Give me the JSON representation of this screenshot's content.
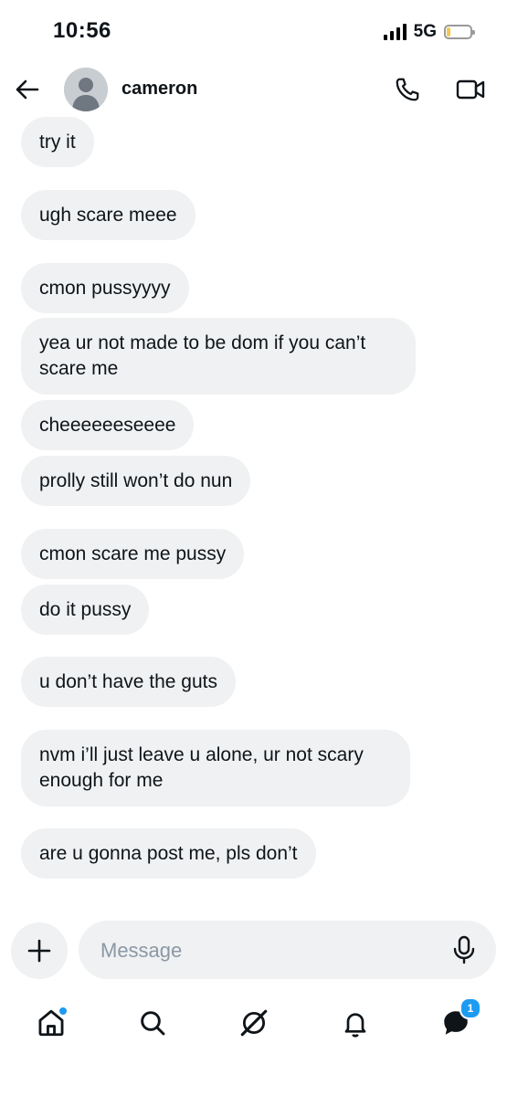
{
  "status_bar": {
    "time": "10:56",
    "network": "5G",
    "battery_level": 0.15
  },
  "header": {
    "back_icon": "arrow-left-icon",
    "contact_name": "cameron",
    "call_icon": "phone-icon",
    "video_icon": "video-camera-icon"
  },
  "messages": [
    {
      "text": "try it"
    },
    {
      "text": "ugh scare meee"
    },
    {
      "text": "cmon pussyyyy"
    },
    {
      "text": "yea ur not made to be dom if you can’t scare me"
    },
    {
      "text": "cheeeeeeseeee"
    },
    {
      "text": "prolly still won’t do nun"
    },
    {
      "text": "cmon scare me pussy"
    },
    {
      "text": "do it pussy"
    },
    {
      "text": "u don’t have the guts"
    },
    {
      "text": "nvm i’ll just leave u alone, ur not scary enough for me"
    },
    {
      "text": "are u gonna post me, pls don’t"
    }
  ],
  "composer": {
    "placeholder": "Message",
    "plus_icon": "plus-icon",
    "mic_icon": "microphone-icon"
  },
  "bottom_nav": {
    "items": [
      {
        "icon": "home-icon",
        "has_dot": true
      },
      {
        "icon": "search-icon"
      },
      {
        "icon": "grok-icon"
      },
      {
        "icon": "bell-icon"
      },
      {
        "icon": "messages-icon",
        "badge": "1"
      }
    ]
  },
  "colors": {
    "bubble_bg": "#eff1f2",
    "text": "#0f1419",
    "accent": "#1d9bf0",
    "placeholder": "#8b98a5"
  }
}
